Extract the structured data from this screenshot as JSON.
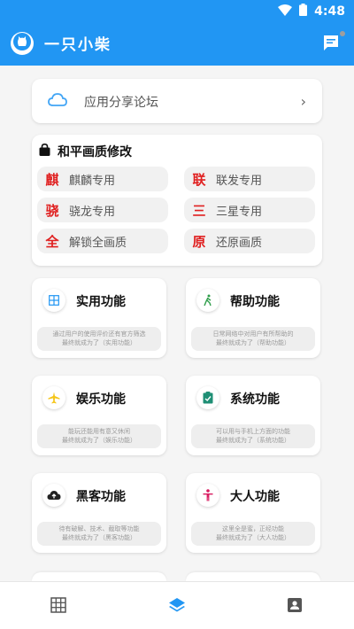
{
  "status_bar": {
    "time": "4:48"
  },
  "app_bar": {
    "title": "一只小柴"
  },
  "forum": {
    "label": "应用分享论坛",
    "chevron": "›"
  },
  "peace_elite": {
    "title": "和平画质修改",
    "items": [
      {
        "char": "麒",
        "label": "麒麟专用"
      },
      {
        "char": "联",
        "label": "联发专用"
      },
      {
        "char": "骁",
        "label": "骁龙专用"
      },
      {
        "char": "三",
        "label": "三星专用"
      },
      {
        "char": "全",
        "label": "解锁全画质"
      },
      {
        "char": "原",
        "label": "还原画质"
      }
    ]
  },
  "features": [
    {
      "title": "实用功能",
      "desc1": "通过用户的使用评价还有官方筛选",
      "desc2": "最终就成为了（实用功能）",
      "icon": "grid-icon",
      "color": "#2196f3"
    },
    {
      "title": "帮助功能",
      "desc1": "日常网络中对用户有所帮助的",
      "desc2": "最终就成为了（帮助功能）",
      "icon": "walk-icon",
      "color": "#2e9d4a"
    },
    {
      "title": "娱乐功能",
      "desc1": "能玩还能用有意又休闲",
      "desc2": "最终就成为了（娱乐功能）",
      "icon": "plane-icon",
      "color": "#f5c518"
    },
    {
      "title": "系统功能",
      "desc1": "可以用与手机上方面的功能",
      "desc2": "最终就成为了（系统功能）",
      "icon": "clipboard-check-icon",
      "color": "#1f8f75"
    },
    {
      "title": "黑客功能",
      "desc1": "待有破解、技术、截取等功能",
      "desc2": "最终就成为了（黑客功能）",
      "icon": "cloud-upload-icon",
      "color": "#222222"
    },
    {
      "title": "大人功能",
      "desc1": "这里全是蜜，正经功能",
      "desc2": "最终就成为了（大人功能）",
      "icon": "person-icon",
      "color": "#d81b60"
    }
  ],
  "bottom_nav": {
    "items": [
      {
        "icon": "grid-icon"
      },
      {
        "icon": "layers-icon",
        "active": true
      },
      {
        "icon": "contact-icon"
      }
    ]
  },
  "colors": {
    "primary": "#2196f3",
    "accent_red": "#e02020"
  }
}
